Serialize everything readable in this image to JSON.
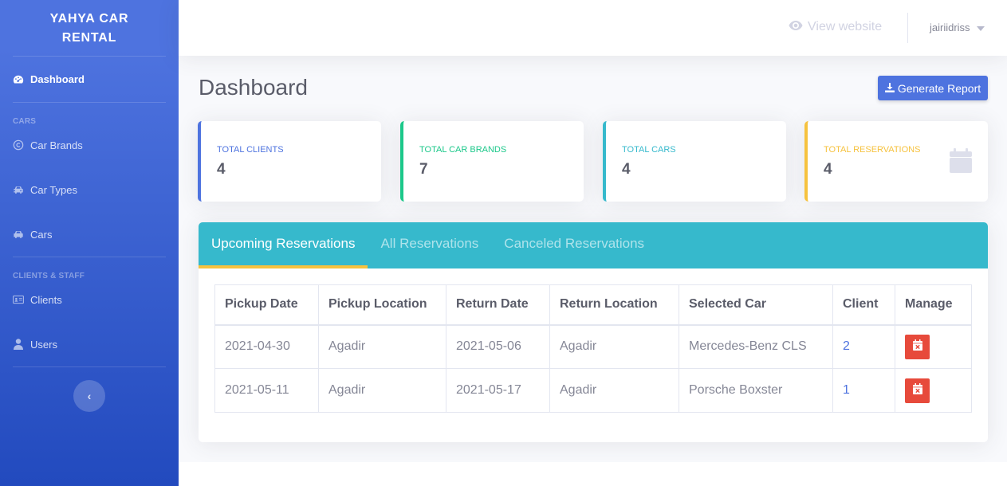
{
  "sidebar": {
    "brand_line1": "YAHYA CAR",
    "brand_line2": "RENTAL",
    "dashboard": "Dashboard",
    "heading_cars": "CARS",
    "car_brands": "Car Brands",
    "car_types": "Car Types",
    "cars": "Cars",
    "heading_clients": "CLIENTS & STAFF",
    "clients": "Clients",
    "users": "Users",
    "toggle_glyph": "‹"
  },
  "topbar": {
    "view_website": "View website",
    "username": "jairiidriss"
  },
  "page": {
    "title": "Dashboard",
    "generate_report": "Generate Report"
  },
  "stats": [
    {
      "label": "TOTAL CLIENTS",
      "value": "4",
      "color": "#4e73df"
    },
    {
      "label": "TOTAL CAR BRANDS",
      "value": "7",
      "color": "#1cc88a"
    },
    {
      "label": "TOTAL CARS",
      "value": "4",
      "color": "#36b9cc"
    },
    {
      "label": "TOTAL RESERVATIONS",
      "value": "4",
      "color": "#f6c23e"
    }
  ],
  "tabs": [
    "Upcoming Reservations",
    "All Reservations",
    "Canceled Reservations"
  ],
  "table": {
    "headers": [
      "Pickup Date",
      "Pickup Location",
      "Return Date",
      "Return Location",
      "Selected Car",
      "Client",
      "Manage"
    ],
    "rows": [
      {
        "pickup_date": "2021-04-30",
        "pickup_location": "Agadir",
        "return_date": "2021-05-06",
        "return_location": "Agadir",
        "car": "Mercedes-Benz CLS",
        "client": "2"
      },
      {
        "pickup_date": "2021-05-11",
        "pickup_location": "Agadir",
        "return_date": "2021-05-17",
        "return_location": "Agadir",
        "car": "Porsche Boxster",
        "client": "1"
      }
    ]
  },
  "colors": {
    "primary": "#4e73df",
    "info": "#36b9cc",
    "warning": "#f6c23e",
    "success": "#1cc88a",
    "danger": "#e74a3b"
  }
}
